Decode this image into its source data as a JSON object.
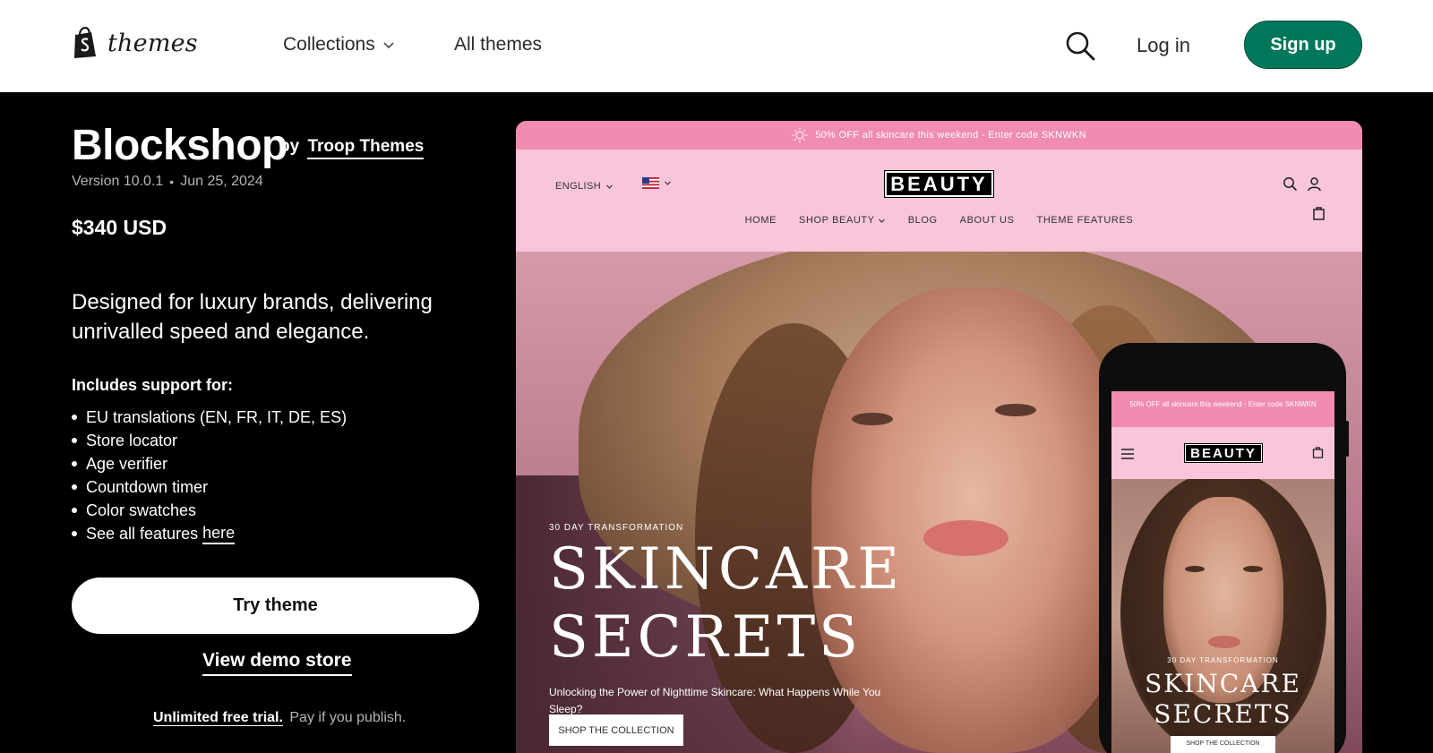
{
  "nav": {
    "brand_word": "themes",
    "collections_label": "Collections",
    "all_themes_label": "All themes",
    "login_label": "Log in",
    "signup_label": "Sign up",
    "accent_color": "#00775b"
  },
  "theme": {
    "name": "Blockshop",
    "by_prefix": "by",
    "developer": "Troop Themes",
    "version": "Version 10.0.1",
    "date": "Jun 25, 2024",
    "price": "$340 USD",
    "tagline": "Designed for luxury brands, delivering unrivalled speed and elegance.",
    "support_heading": "Includes support for:",
    "features": [
      "EU translations (EN, FR, IT, DE, ES)",
      "Store locator",
      "Age verifier",
      "Countdown timer",
      "Color swatches"
    ],
    "see_all_prefix": "See all features",
    "see_all_link": "here",
    "try_label": "Try theme",
    "demo_label": "View demo store",
    "trial_strong": "Unlimited free trial.",
    "trial_rest": "Pay if you publish."
  },
  "preview": {
    "announcement": "50% OFF all skincare this weekend - Enter code SKNWKN",
    "language": "ENGLISH",
    "logo": "BEAUTY",
    "nav": [
      "HOME",
      "SHOP BEAUTY",
      "BLOG",
      "ABOUT US",
      "THEME FEATURES"
    ],
    "hero_kicker": "30 DAY TRANSFORMATION",
    "hero_line1": "SKINCARE",
    "hero_line2": "SECRETS",
    "hero_sub": "Unlocking the Power of Nighttime Skincare: What Happens While You Sleep?",
    "shop_label": "SHOP THE COLLECTION",
    "announce_color": "#f08bb1",
    "header_color": "#f8c5da"
  },
  "mobile": {
    "announcement": "50% OFF all skincare this weekend - Enter code SKNWKN",
    "logo": "BEAUTY",
    "kicker": "30 DAY TRANSFORMATION",
    "line1": "SKINCARE",
    "line2": "SECRETS",
    "shop_label": "SHOP THE COLLECTION"
  }
}
